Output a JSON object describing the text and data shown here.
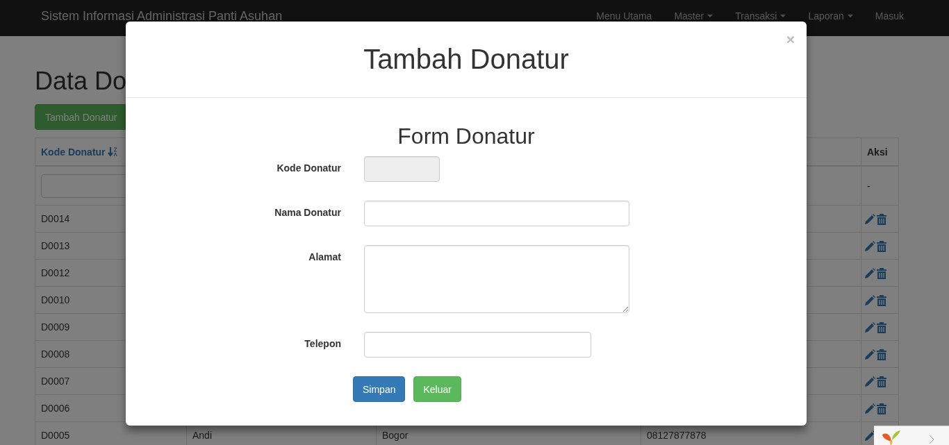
{
  "navbar": {
    "brand": "Sistem Informasi Administrasi Panti Asuhan",
    "items": [
      {
        "label": "Menu Utama",
        "dropdown": false
      },
      {
        "label": "Master",
        "dropdown": true
      },
      {
        "label": "Transaksi",
        "dropdown": true
      },
      {
        "label": "Laporan",
        "dropdown": true
      },
      {
        "label": "Masuk",
        "dropdown": false
      }
    ]
  },
  "page": {
    "title": "Data Do",
    "add_button": "Tambah Donatur"
  },
  "table": {
    "columns": [
      {
        "label": "Kode Donatur",
        "sortable": true
      },
      {
        "label": "Aksi",
        "sortable": false
      }
    ],
    "filter_placeholder_cells": [
      "-"
    ],
    "rows": [
      {
        "code": "D0014"
      },
      {
        "code": "D0013"
      },
      {
        "code": "D0012"
      },
      {
        "code": "D0010"
      },
      {
        "code": "D0009"
      },
      {
        "code": "D0008"
      },
      {
        "code": "D0007"
      },
      {
        "code": "D0006"
      },
      {
        "code": "D0005",
        "name": "Andi",
        "address": "Bogor",
        "phone": "08127877878"
      }
    ]
  },
  "modal": {
    "title": "Tambah Donatur",
    "close": "×",
    "form_title": "Form Donatur",
    "fields": [
      {
        "label": "Kode Donatur",
        "kind": "code",
        "disabled": true
      },
      {
        "label": "Nama Donatur",
        "kind": "text",
        "disabled": false
      },
      {
        "label": "Alamat",
        "kind": "textarea",
        "disabled": false
      },
      {
        "label": "Telepon",
        "kind": "phone",
        "disabled": false
      }
    ],
    "buttons": [
      {
        "label": "Simpan",
        "kind": "primary"
      },
      {
        "label": "Keluar",
        "kind": "success"
      }
    ]
  }
}
